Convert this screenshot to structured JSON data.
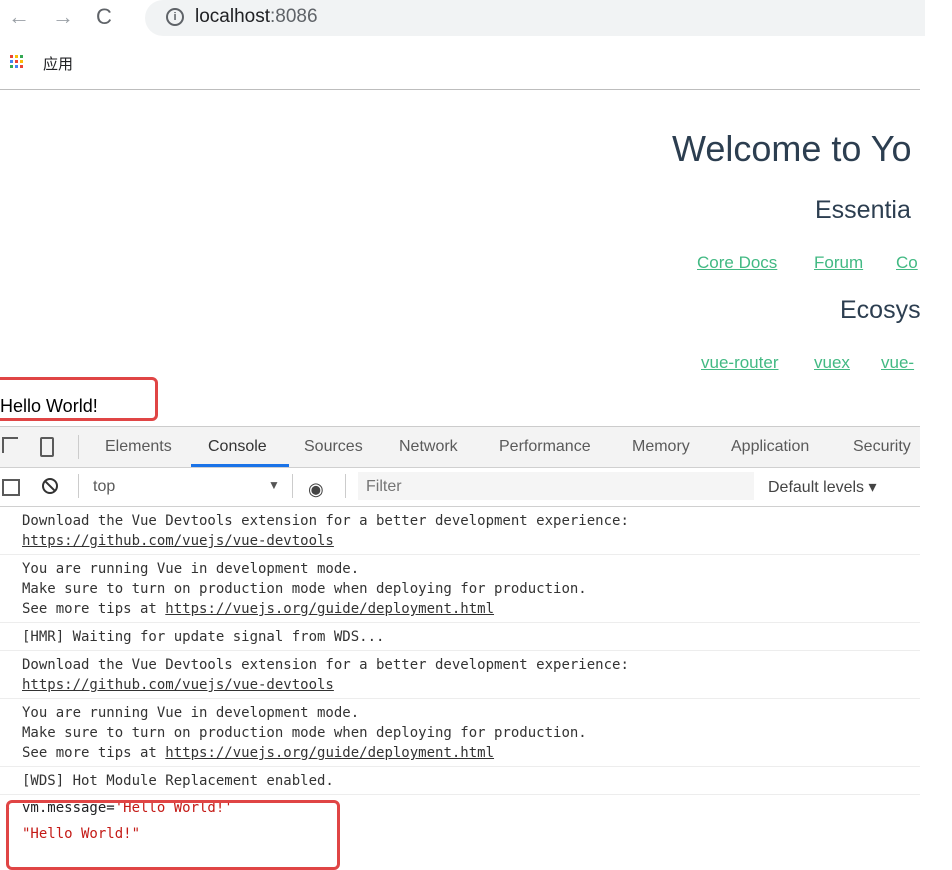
{
  "browser": {
    "url_host": "localhost",
    "url_port": ":8086",
    "bookmark_apps_label": "应用"
  },
  "page": {
    "heading": "Welcome to Yo",
    "essential_heading": "Essentia",
    "essential_links": [
      "Core Docs",
      "Forum",
      "Co"
    ],
    "ecosystem_heading": "Ecosys",
    "ecosystem_links": [
      "vue-router",
      "vuex",
      "vue-"
    ],
    "message": "Hello World!"
  },
  "devtools": {
    "tabs": [
      "Elements",
      "Console",
      "Sources",
      "Network",
      "Performance",
      "Memory",
      "Application",
      "Security"
    ],
    "active_tab": "Console",
    "context": "top",
    "filter_placeholder": "Filter",
    "levels": "Default levels ▾"
  },
  "console": {
    "messages": [
      {
        "line1": "Download the Vue Devtools extension for a better development experience:",
        "link": "https://github.com/vuejs/vue-devtools"
      },
      {
        "line1": "You are running Vue in development mode.",
        "line2": "Make sure to turn on production mode when deploying for production.",
        "line3_prefix": "See more tips at ",
        "link": "https://vuejs.org/guide/deployment.html"
      },
      {
        "line1": "[HMR] Waiting for update signal from WDS..."
      },
      {
        "line1": "Download the Vue Devtools extension for a better development experience:",
        "link": "https://github.com/vuejs/vue-devtools"
      },
      {
        "line1": "You are running Vue in development mode.",
        "line2": "Make sure to turn on production mode when deploying for production.",
        "line3_prefix": "See more tips at ",
        "link": "https://vuejs.org/guide/deployment.html"
      },
      {
        "line1": "[WDS] Hot Module Replacement enabled."
      }
    ],
    "command_prefix": "vm.message=",
    "command_string": "'Hello World!'",
    "result": "\"Hello World!\""
  },
  "colors": {
    "vue_green": "#42b983",
    "heading": "#2c3e50",
    "highlight_red": "#e04545",
    "string_red": "#c41a16"
  }
}
